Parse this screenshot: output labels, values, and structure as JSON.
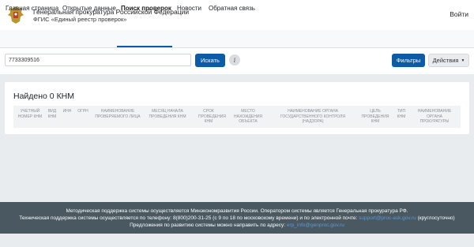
{
  "header": {
    "org_title": "Генеральная прокуратура Российской Федерации",
    "org_subtitle": "ФГИС «Единый реестр проверок»",
    "login": "Войти",
    "emblem_icon": "russian-coat-of-arms-icon"
  },
  "nav": {
    "items": [
      {
        "label": "Главная страница",
        "active": false
      },
      {
        "label": "Открытые данные",
        "active": false
      },
      {
        "label": "Поиск проверок",
        "active": true
      },
      {
        "label": "Новости",
        "active": false
      },
      {
        "label": "Обратная связь",
        "active": false
      }
    ],
    "accent": "#0d5aa7"
  },
  "search": {
    "value": "7733309516",
    "button": "Искать",
    "info_icon": "i",
    "filters_button": "Фильтры",
    "actions_button": "Действия"
  },
  "results": {
    "found": "Найдено 0 КНМ",
    "columns": [
      "Учетный номер КНМ",
      "Вид КНМ",
      "ИНН",
      "ОГРН",
      "Наименование проверяемого лица",
      "Месяц начала проведения КНМ",
      "Срок проведения КНМ",
      "Место нахождения объекта",
      "Наименование органа государственного контроля (надзора)",
      "Цель проведения КНМ",
      "Тип КНМ",
      "Наименование органа прокуратуры"
    ]
  },
  "footer": {
    "line1": "Методическая поддержка системы осуществляется Минэкономразвития России. Оператором системы является Генеральная прокуратура РФ.",
    "line2_prefix": "Техническая поддержка системы осуществляется по телефону: 8(800)200-31-25 (с 9 по 18 по московскому времени) и по электронной почте:",
    "line2_link": "support@proc-ask.gov.ru",
    "line2_suffix": "(круглосуточно)",
    "line3_prefix": "Предложения по развитию системы можно направить по адресу:",
    "line3_link": "erp_info@genproc.gov.ru"
  }
}
